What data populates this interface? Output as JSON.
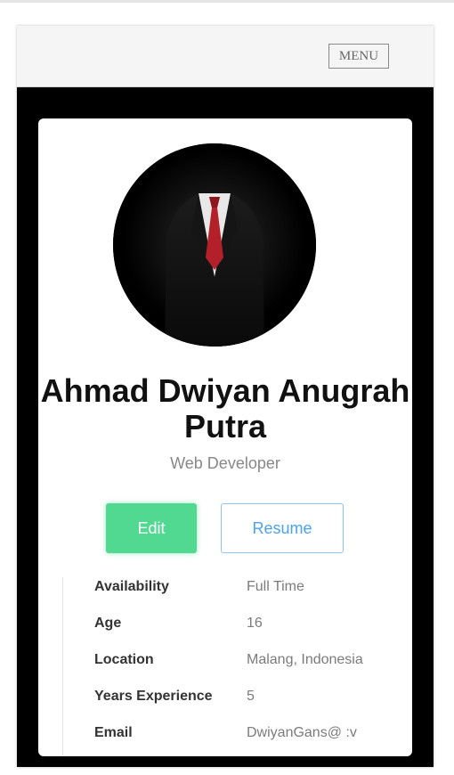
{
  "header": {
    "menu_label": "MENU"
  },
  "profile": {
    "name": "Ahmad Dwiyan Anugrah Putra",
    "role": "Web Developer",
    "actions": {
      "edit_label": "Edit",
      "resume_label": "Resume"
    },
    "details": [
      {
        "label": "Availability",
        "value": "Full Time"
      },
      {
        "label": "Age",
        "value": "16"
      },
      {
        "label": "Location",
        "value": "Malang, Indonesia"
      },
      {
        "label": "Years Experience",
        "value": "5"
      },
      {
        "label": "Email",
        "value": "DwiyanGans@ :v"
      }
    ]
  },
  "colors": {
    "edit_button": "#52d991",
    "resume_border": "#8ec3f5",
    "resume_text": "#4aa3f0",
    "page_frame": "#000000"
  }
}
